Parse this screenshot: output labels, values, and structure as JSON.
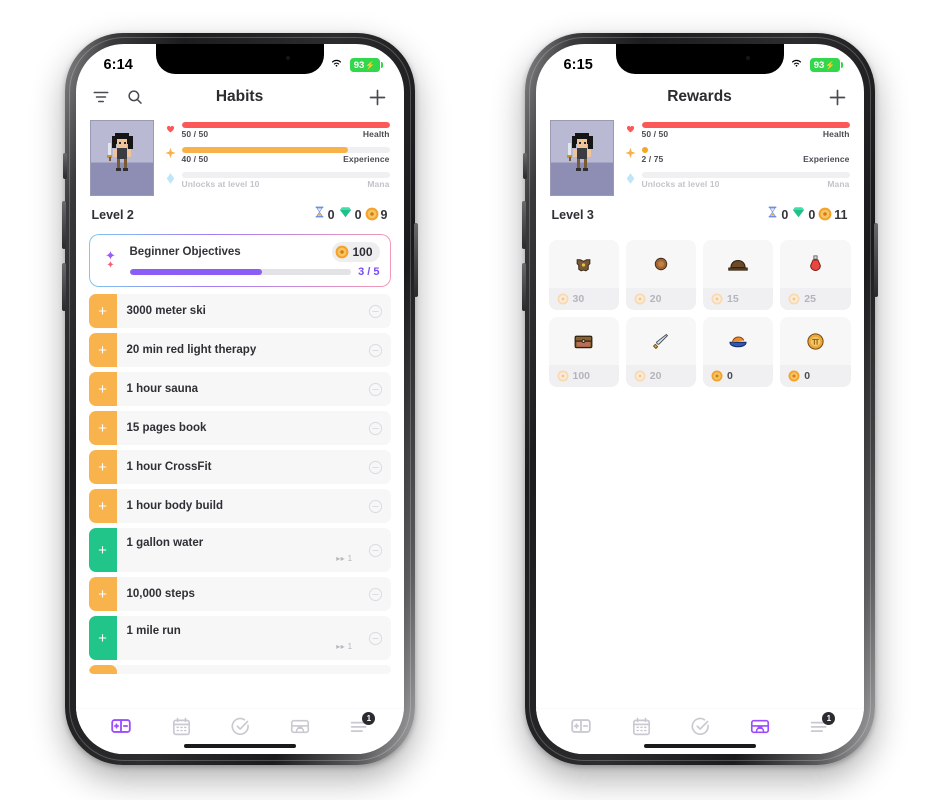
{
  "phones": [
    {
      "id": "habits",
      "status": {
        "time": "6:14",
        "wifi_icon": "wifi-icon",
        "battery": "93",
        "battery_icon": "battery-charging-icon"
      },
      "nav": {
        "title": "Habits",
        "filter_icon": "filter-icon",
        "search_icon": "search-icon",
        "add_icon": "plus-icon"
      },
      "hero": {
        "avatar_icon": "pixel-knight-avatar",
        "bars": [
          {
            "icon": "heart-icon",
            "label": "Health",
            "value": "50 / 50",
            "percent": 100,
            "color": "#fc5858",
            "locked": false
          },
          {
            "icon": "sparkle-icon",
            "label": "Experience",
            "value": "40 / 50",
            "percent": 80,
            "color": "#f9b24a",
            "locked": false
          },
          {
            "icon": "mana-diamond-icon",
            "label": "Mana",
            "value": "Unlocks at level 10",
            "percent": 0,
            "color": "#9ad9f5",
            "locked": true
          }
        ],
        "level": "Level 2",
        "currencies": [
          {
            "icon": "hourglass-icon",
            "value": "0"
          },
          {
            "icon": "gem-icon",
            "value": "0"
          },
          {
            "icon": "coin-icon",
            "value": "9"
          }
        ]
      },
      "objectives": {
        "icon": "sparkle-star-icon",
        "title": "Beginner Objectives",
        "reward": "100",
        "reward_icon": "coin-icon",
        "progress": "3 / 5",
        "percent": 60
      },
      "habits": [
        {
          "name": "3000 meter ski",
          "color": "#f9b34d",
          "repeat": ""
        },
        {
          "name": "20 min red light therapy",
          "color": "#f9b34d",
          "repeat": ""
        },
        {
          "name": "1 hour sauna",
          "color": "#f9b34d",
          "repeat": ""
        },
        {
          "name": "15 pages book",
          "color": "#f9b34d",
          "repeat": ""
        },
        {
          "name": "1 hour CrossFit",
          "color": "#f9b34d",
          "repeat": ""
        },
        {
          "name": "1 hour body build",
          "color": "#f9b34d",
          "repeat": ""
        },
        {
          "name": "1 gallon water",
          "color": "#21c58a",
          "repeat": "▸▸ 1"
        },
        {
          "name": "10,000 steps",
          "color": "#f9b34d",
          "repeat": ""
        },
        {
          "name": "1 mile run",
          "color": "#21c58a",
          "repeat": "▸▸ 1"
        }
      ],
      "partial_habit_color": "#f9b34d",
      "tabs": [
        {
          "name": "tab-habits",
          "icon": "plus-minus-icon",
          "active": true,
          "badge": ""
        },
        {
          "name": "tab-calendar",
          "icon": "calendar-icon",
          "active": false,
          "badge": ""
        },
        {
          "name": "tab-tasks",
          "icon": "check-circle-icon",
          "active": false,
          "badge": ""
        },
        {
          "name": "tab-rewards",
          "icon": "chest-icon",
          "active": false,
          "badge": ""
        },
        {
          "name": "tab-menu",
          "icon": "list-icon",
          "active": false,
          "badge": "1"
        }
      ]
    },
    {
      "id": "rewards",
      "status": {
        "time": "6:15",
        "wifi_icon": "wifi-icon",
        "battery": "93",
        "battery_icon": "battery-charging-icon"
      },
      "nav": {
        "title": "Rewards",
        "filter_icon": "",
        "search_icon": "",
        "add_icon": "plus-icon"
      },
      "hero": {
        "avatar_icon": "pixel-knight-avatar",
        "bars": [
          {
            "icon": "heart-icon",
            "label": "Health",
            "value": "50 / 50",
            "percent": 100,
            "color": "#fc5858",
            "locked": false
          },
          {
            "icon": "sparkle-icon",
            "label": "Experience",
            "value": "2 / 75",
            "percent": 3,
            "color": "#f9b24a",
            "locked": false
          },
          {
            "icon": "mana-diamond-icon",
            "label": "Mana",
            "value": "Unlocks at level 10",
            "percent": 0,
            "color": "#9ad9f5",
            "locked": true
          }
        ],
        "level": "Level 3",
        "currencies": [
          {
            "icon": "hourglass-icon",
            "value": "0"
          },
          {
            "icon": "gem-icon",
            "value": "0"
          },
          {
            "icon": "coin-icon",
            "value": "11"
          }
        ]
      },
      "rewards": [
        {
          "icon": "armor-icon",
          "cost": "30",
          "affordable": false
        },
        {
          "icon": "shield-icon",
          "cost": "20",
          "affordable": false
        },
        {
          "icon": "hat-icon",
          "cost": "15",
          "affordable": false
        },
        {
          "icon": "potion-icon",
          "cost": "25",
          "affordable": false
        },
        {
          "icon": "chest-icon",
          "cost": "100",
          "affordable": false
        },
        {
          "icon": "sword-icon",
          "cost": "20",
          "affordable": false
        },
        {
          "icon": "food-icon",
          "cost": "0",
          "affordable": true
        },
        {
          "icon": "pie-coin-icon",
          "cost": "0",
          "affordable": true
        }
      ],
      "tabs": [
        {
          "name": "tab-habits",
          "icon": "plus-minus-icon",
          "active": false,
          "badge": ""
        },
        {
          "name": "tab-calendar",
          "icon": "calendar-icon",
          "active": false,
          "badge": ""
        },
        {
          "name": "tab-tasks",
          "icon": "check-circle-icon",
          "active": false,
          "badge": ""
        },
        {
          "name": "tab-rewards",
          "icon": "chest-icon",
          "active": true,
          "badge": ""
        },
        {
          "name": "tab-menu",
          "icon": "list-icon",
          "active": false,
          "badge": "1"
        }
      ]
    }
  ],
  "colors": {
    "accent_purple": "#9b4dff",
    "progress_purple": "#8b5cf6",
    "health_red": "#fc5858",
    "xp_orange": "#f9b24a",
    "habit_orange": "#f9b34d",
    "habit_green": "#21c58a",
    "coin_gold": "#f2a22c",
    "battery_green": "#32d74b"
  }
}
